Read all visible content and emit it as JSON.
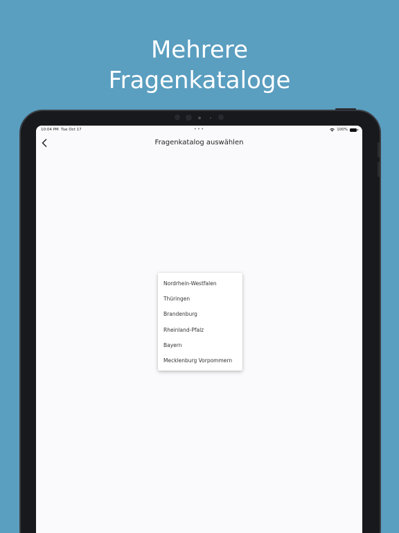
{
  "headline": {
    "line1": "Mehrere",
    "line2": "Fragenkataloge"
  },
  "status_bar": {
    "time": "10:04 PM",
    "date": "Tue Oct 17",
    "dots": "•••",
    "battery": "100%",
    "wifi_icon": "wifi-icon",
    "battery_icon": "battery-icon"
  },
  "nav": {
    "title": "Fragenkatalog auswählen",
    "back_icon": "chevron-left-icon"
  },
  "menu": {
    "items": [
      {
        "label": "Nordrhein-Westfalen"
      },
      {
        "label": "Thüringen"
      },
      {
        "label": "Brandenburg"
      },
      {
        "label": "Rheinland-Pfalz"
      },
      {
        "label": "Bayern"
      },
      {
        "label": "Mecklenburg Vorpommern"
      }
    ]
  },
  "colors": {
    "background": "#5a9ec0",
    "device": "#17191c",
    "screen": "#fafafc"
  }
}
